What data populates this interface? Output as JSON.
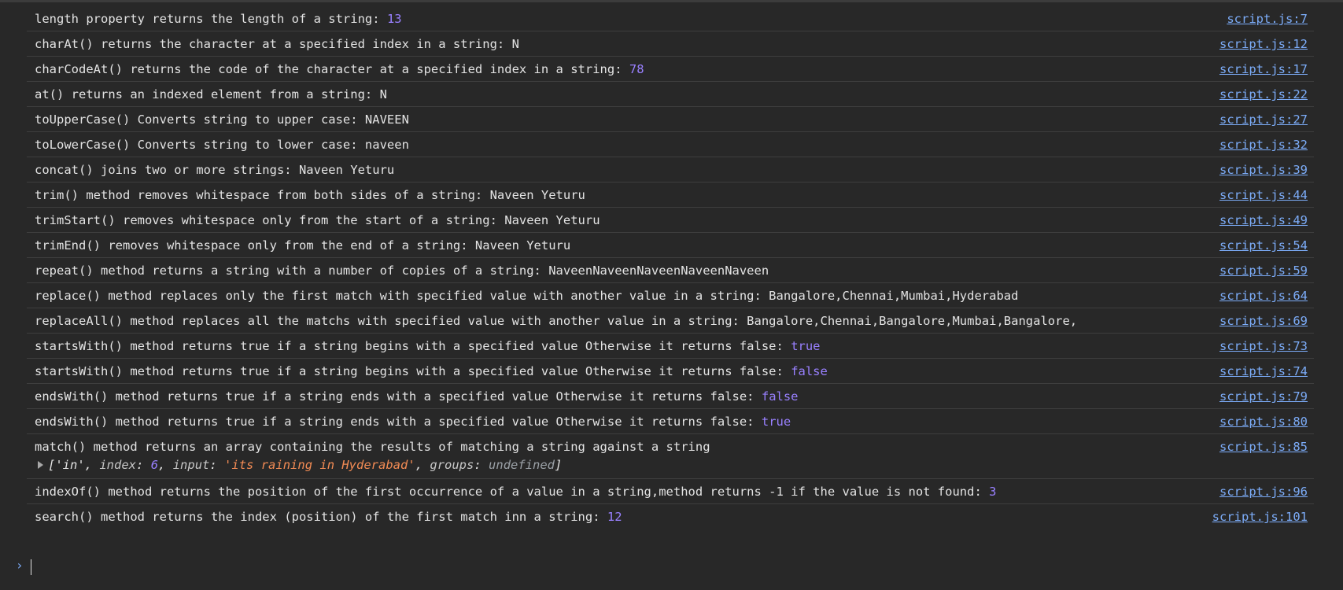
{
  "console": {
    "rows": [
      {
        "text": "length property returns the length of a string: ",
        "value": "13",
        "source": "script.js:7"
      },
      {
        "text": "charAt() returns the character at a specified index in a string: N",
        "source": "script.js:12"
      },
      {
        "text": "charCodeAt() returns the code of the character at a specified index in a string: ",
        "value": "78",
        "source": "script.js:17"
      },
      {
        "text": "at() returns an indexed element from a string: N",
        "source": "script.js:22"
      },
      {
        "text": "toUpperCase() Converts string to upper case: NAVEEN",
        "source": "script.js:27"
      },
      {
        "text": "toLowerCase() Converts string to lower case: naveen",
        "source": "script.js:32"
      },
      {
        "text": "concat() joins two or more strings: Naveen Yeturu",
        "source": "script.js:39"
      },
      {
        "text": "trim() method removes whitespace from both sides of a string: Naveen Yeturu",
        "source": "script.js:44"
      },
      {
        "text": "trimStart() removes whitespace only from the start of a string: Naveen Yeturu",
        "source": "script.js:49"
      },
      {
        "text": "trimEnd() removes whitespace only from the end of a string: Naveen Yeturu",
        "source": "script.js:54"
      },
      {
        "text": "repeat() method returns a string with a number of copies of a string: NaveenNaveenNaveenNaveenNaveen",
        "source": "script.js:59"
      },
      {
        "text": "replace() method replaces only the first match with specified value with another value in a string: Bangalore,Chennai,Mumbai,Hyderabad",
        "source": "script.js:64"
      },
      {
        "text": "replaceAll() method replaces all the matchs with specified value with another value in a string: Bangalore,Chennai,Bangalore,Mumbai,Bangalore,",
        "source": "script.js:69"
      },
      {
        "text": "startsWith() method returns true if a string begins with a specified value Otherwise it returns false: ",
        "value": "true",
        "source": "script.js:73"
      },
      {
        "text": "startsWith() method returns true if a string begins with a specified value Otherwise it returns false: ",
        "value": "false",
        "source": "script.js:74"
      },
      {
        "text": "endsWith() method returns true if a string ends with a specified value Otherwise it returns false: ",
        "value": "false",
        "source": "script.js:79"
      },
      {
        "text": "endsWith() method returns true if a string ends with a specified value Otherwise it returns false: ",
        "value": "true",
        "source": "script.js:80"
      },
      {
        "text": "match() method returns an array containing the results of matching a string against a string",
        "source": "script.js:85"
      },
      {
        "text": "indexOf() method returns the position of the first occurrence of a value in a string,method returns -1 if the value is not found: ",
        "value": "3",
        "source": "script.js:96"
      },
      {
        "text": "search() method returns the index (position) of the first match inn a string: ",
        "value": "12",
        "source": "script.js:101"
      }
    ],
    "match_array": {
      "open": "['in'",
      "index_key": "index",
      "index_val": "6",
      "input_key": "input",
      "input_val": "'its raining in Hyderabad'",
      "groups_key": "groups",
      "groups_val": "undefined",
      "close": "]"
    },
    "prompt_glyph": "›"
  },
  "colors": {
    "background": "#282828",
    "text": "#e3e3e3",
    "link": "#7cacf8",
    "number": "#9980ff",
    "string": "#f28b54"
  }
}
